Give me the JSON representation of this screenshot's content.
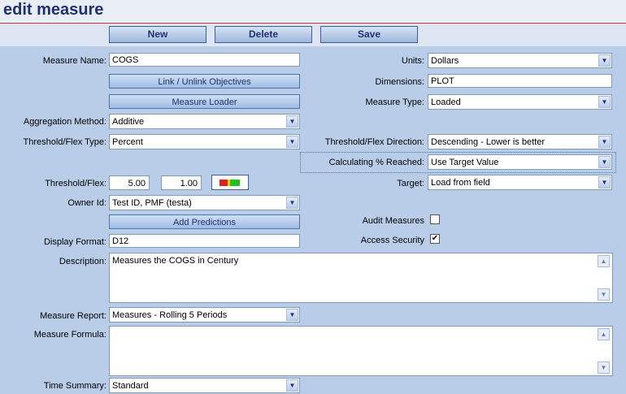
{
  "title": "edit measure",
  "toolbar": {
    "new": "New",
    "delete": "Delete",
    "save": "Save"
  },
  "form": {
    "measure_name_label": "Measure Name:",
    "measure_name": "COGS",
    "link_objectives": "Link / Unlink Objectives",
    "measure_loader": "Measure Loader",
    "aggregation_label": "Aggregation Method:",
    "aggregation": "Additive",
    "threshold_type_label": "Threshold/Flex Type:",
    "threshold_type": "Percent",
    "threshold_label": "Threshold/Flex:",
    "threshold_value1": "5.00",
    "threshold_value2": "1.00",
    "owner_label": "Owner Id:",
    "owner": "Test ID, PMF (testa)",
    "add_predictions": "Add Predictions",
    "display_format_label": "Display Format:",
    "display_format": "D12",
    "description_label": "Description:",
    "description": "Measures the COGS in Century",
    "measure_report_label": "Measure Report:",
    "measure_report": "Measures - Rolling 5 Periods",
    "measure_formula_label": "Measure Formula:",
    "measure_formula": "",
    "time_summary_label": "Time Summary:",
    "time_summary": "Standard",
    "units_label": "Units:",
    "units": "Dollars",
    "dimensions_label": "Dimensions:",
    "dimensions": "PLOT",
    "measure_type_label": "Measure Type:",
    "measure_type": "Loaded",
    "direction_label": "Threshold/Flex Direction:",
    "direction": "Descending - Lower is better",
    "calc_label": "Calculating % Reached:",
    "calc": "Use Target Value",
    "target_label": "Target:",
    "target": "Load from field",
    "audit_label": "Audit Measures",
    "audit_checked": false,
    "access_label": "Access Security",
    "access_checked": true
  },
  "icons": {
    "dropdown": "chevron-down-icon",
    "flex": "threshold-color-icon"
  },
  "colors": {
    "title": "#203070",
    "background": "#b9cde8",
    "accent_line": "#c0392b"
  }
}
